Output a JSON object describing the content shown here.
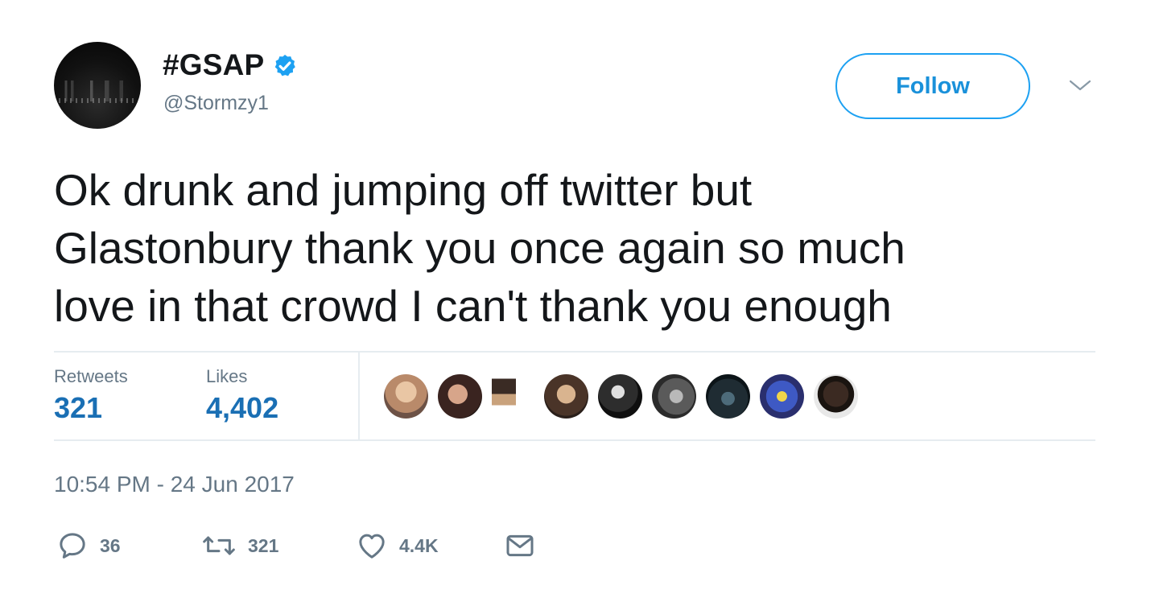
{
  "author": {
    "display_name": "#GSAP",
    "handle": "@Stormzy1",
    "verified": true
  },
  "follow_label": "Follow",
  "tweet": {
    "lines": [
      "Ok drunk and jumping off twitter but",
      "Glastonbury thank you once again so much",
      "love in that crowd I can't thank you enough"
    ]
  },
  "stats": {
    "retweets_label": "Retweets",
    "retweets_value": "321",
    "likes_label": "Likes",
    "likes_value": "4,402"
  },
  "timestamp": "10:54 PM - 24 Jun 2017",
  "actions": {
    "reply_count": "36",
    "retweet_count": "321",
    "like_count": "4.4K"
  },
  "colors": {
    "accent": "#1da1f2",
    "stat_value": "#1a6fb4",
    "muted": "#657786",
    "text": "#14171a"
  }
}
